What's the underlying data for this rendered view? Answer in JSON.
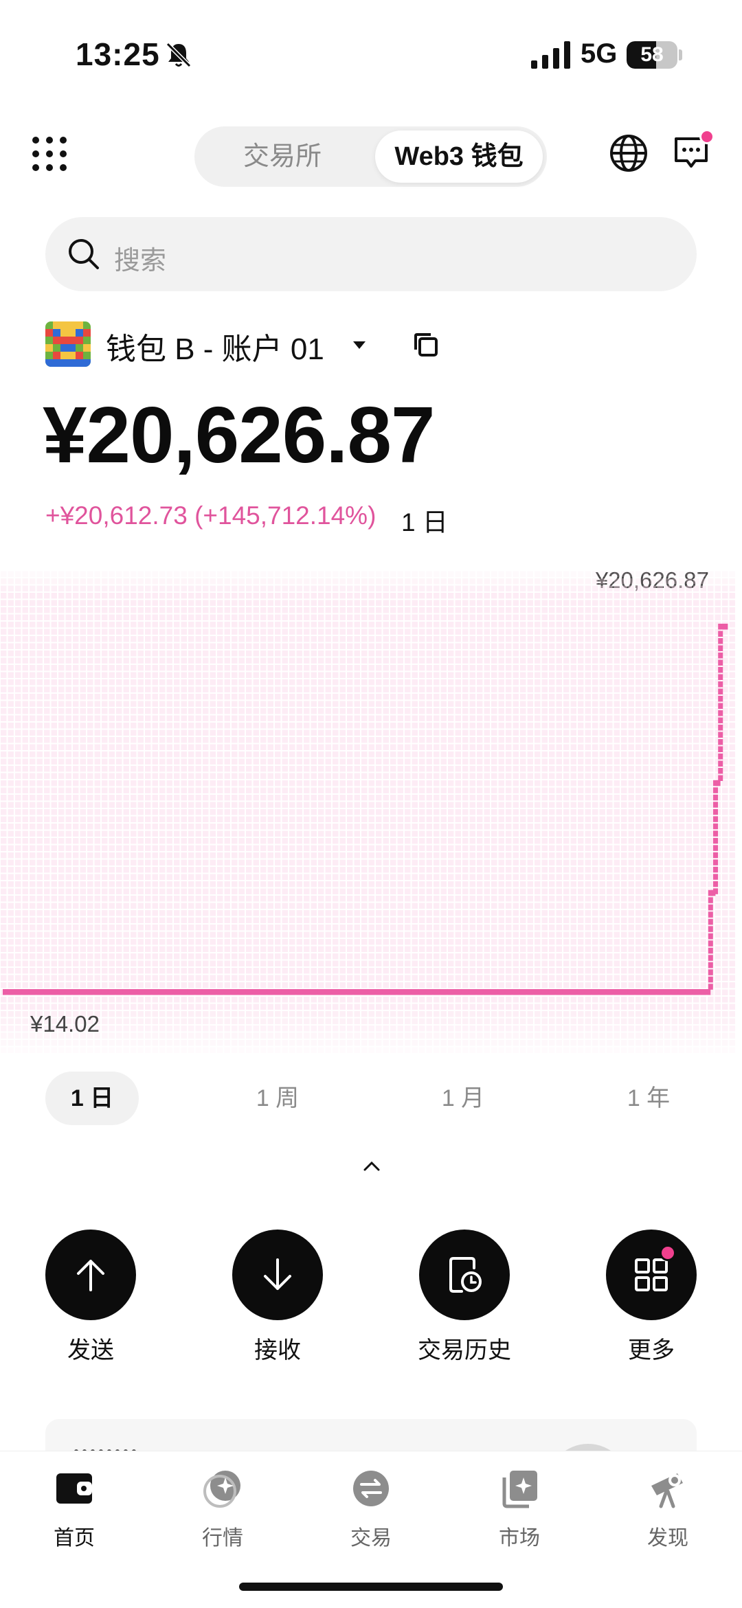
{
  "status_bar": {
    "time": "13:25",
    "network": "5G",
    "battery": "58",
    "battery_level": 0.58
  },
  "header": {
    "tabs": [
      {
        "label": "交易所",
        "active": false
      },
      {
        "label": "Web3 钱包",
        "active": true
      }
    ],
    "icons": [
      "grid-menu-icon",
      "globe-icon",
      "message-icon"
    ]
  },
  "search": {
    "placeholder": "搜索"
  },
  "account": {
    "name": "钱包 B - 账户 01"
  },
  "balance": {
    "amount": "¥20,626.87",
    "change": "+¥20,612.73 (+145,712.14%)",
    "period": "1 日"
  },
  "chart_data": {
    "type": "area",
    "y_max_label": "¥20,626.87",
    "y_min_label": "¥14.02",
    "ylim": [
      14.02,
      20626.87
    ],
    "values": [
      14.02,
      14.02,
      14.02,
      14.02,
      14.02,
      14.02,
      14.02,
      14.02,
      14.02,
      14.02,
      14.02,
      14.02,
      14.02,
      14.02,
      14.02,
      14.02,
      14.02,
      14.02,
      14.02,
      14.02,
      14.02,
      14.02,
      14.02,
      14.02,
      14.02,
      14.02,
      14.02,
      14.02,
      14.02,
      14.02,
      14.02,
      14.02,
      14.02,
      14.02,
      14.02,
      14.02,
      14.02,
      14.02,
      14.02,
      14.02,
      14.02,
      14.02,
      14.02,
      14.02,
      14.02,
      14.02,
      14.02,
      14.02,
      14.02,
      14.02,
      14.02,
      14.02,
      14.02,
      14.02,
      14.02,
      14.02,
      14.02,
      14.02,
      14.02,
      14.02,
      14.02,
      14.02,
      14.02,
      14.02,
      14.02,
      14.02,
      14.02,
      14.02,
      14.02,
      14.02,
      14.02,
      14.02,
      14.02,
      14.02,
      14.02,
      14.02,
      14.02,
      14.02,
      14.02,
      14.02,
      14.02,
      14.02,
      14.02,
      14.02,
      14.02,
      14.02,
      14.02,
      14.02,
      14.02,
      14.02,
      14.02,
      14.02,
      14.02,
      14.02,
      14.02,
      14.02,
      14.02,
      14.02,
      14.02,
      14.02,
      14.02,
      14.02,
      14.02,
      14.02,
      14.02,
      14.02,
      14.02,
      14.02,
      14.02,
      14.02,
      14.02,
      14.02,
      14.02,
      14.02,
      14.02,
      14.02,
      14.02,
      14.02,
      14.02,
      14.02,
      14.02,
      14.02,
      14.02,
      14.02,
      14.02,
      14.02,
      14.02,
      14.02,
      14.02,
      14.02,
      14.02,
      14.02,
      14.02,
      14.02,
      14.02,
      14.02,
      14.02,
      14.02,
      14.02,
      14.02,
      14.02,
      14.02,
      14.02,
      14.02,
      14.02,
      14.02,
      14.02,
      14.02,
      14.02,
      14.02,
      14.02,
      14.02,
      14.02,
      14.02,
      14.02,
      14.02,
      14.02,
      14.02,
      14.02,
      14.02,
      14.02,
      14.02,
      14.02,
      14.02,
      14.02,
      14.02,
      14.02,
      14.02,
      14.02,
      14.02,
      14.02,
      14.02,
      14.02,
      14.02,
      14.02,
      14.02,
      14.02,
      14.02,
      14.02,
      14.02,
      14.02,
      14.02,
      14.02,
      14.02,
      14.02,
      14.02,
      14.02,
      14.02,
      14.02,
      14.02,
      14.02,
      14.02,
      14.02,
      14.02,
      14.02,
      14.02,
      14.02,
      14.02,
      14.02,
      14.02,
      14.02,
      14.02,
      14.02,
      14.02,
      14.02,
      14.02,
      14.02,
      14.02,
      14.02,
      14.02,
      14.02,
      14.02,
      14.02,
      14.02,
      14.02,
      14.02,
      14.02,
      14.02,
      14.02,
      14.02,
      14.02,
      14.02,
      14.02,
      14.02,
      14.02,
      14.02,
      14.02,
      14.02,
      14.02,
      14.02,
      14.02,
      14.02,
      14.02,
      14.02,
      14.02,
      14.02,
      14.02,
      14.02,
      14.02,
      14.02,
      14.02,
      14.02,
      14.02,
      14.02,
      14.02,
      14.02,
      14.02,
      14.02,
      14.02,
      14.02,
      14.02,
      14.02,
      14.02,
      14.02,
      14.02,
      14.02,
      14.02,
      14.02,
      14.02,
      14.02,
      14.02,
      14.02,
      14.02,
      14.02,
      14.02,
      14.02,
      14.02,
      14.02,
      14.02,
      14.02,
      14.02,
      14.02,
      14.02,
      14.02,
      14.02,
      14.02,
      14.02,
      14.02,
      14.02,
      14.02,
      14.02,
      14.02,
      14.02,
      14.02,
      14.02,
      5600,
      5600,
      11800,
      11800,
      20626.87,
      20626.87,
      20626.87
    ],
    "line_color": "#ec5ea6"
  },
  "ranges": [
    {
      "label": "1 日",
      "active": true
    },
    {
      "label": "1 周",
      "active": false
    },
    {
      "label": "1 月",
      "active": false
    },
    {
      "label": "1 年",
      "active": false
    }
  ],
  "actions": [
    {
      "label": "发送",
      "icon": "send-arrow-up-icon"
    },
    {
      "label": "接收",
      "icon": "receive-arrow-down-icon"
    },
    {
      "label": "交易历史",
      "icon": "history-icon"
    },
    {
      "label": "更多",
      "icon": "more-grid-icon",
      "badge": true
    }
  ],
  "tabbar": [
    {
      "label": "首页",
      "icon": "wallet-icon",
      "active": true
    },
    {
      "label": "行情",
      "icon": "market-icon",
      "active": false
    },
    {
      "label": "交易",
      "icon": "swap-icon",
      "active": false
    },
    {
      "label": "市场",
      "icon": "nft-market-icon",
      "active": false
    },
    {
      "label": "发现",
      "icon": "telescope-icon",
      "active": false
    }
  ],
  "colors": {
    "accent": "#ec5ea6",
    "badge": "#f0408e",
    "dark": "#0c0c0c"
  }
}
